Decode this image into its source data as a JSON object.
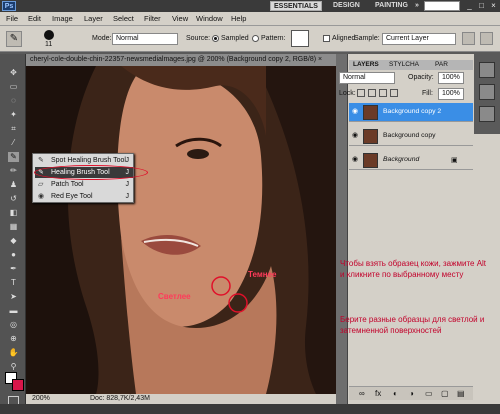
{
  "app": {
    "logo": "Ps",
    "workspaces": [
      "ESSENTIALS",
      "DESIGN",
      "PAINTING"
    ],
    "more": "»",
    "win_buttons": [
      "_",
      "□",
      "×"
    ]
  },
  "menu": [
    "File",
    "Edit",
    "Image",
    "Layer",
    "Select",
    "Filter",
    "View",
    "Window",
    "Help"
  ],
  "options": {
    "brush_size": "11",
    "mode_label": "Mode:",
    "mode_value": "Normal",
    "source_label": "Source:",
    "sampled_label": "Sampled",
    "pattern_label": "Pattern:",
    "aligned_label": "Aligned",
    "sample_label": "Sample:",
    "sample_value": "Current Layer"
  },
  "document": {
    "tab_title": "cheryl-cole-double-chin-22357-newsmedialmages.jpg @ 200% (Background copy 2, RGB/8) ×",
    "zoom": "200%",
    "doc_info": "Doc: 828,7K/2,43M"
  },
  "flyout": {
    "items": [
      {
        "label": "Spot Healing Brush Tool",
        "shortcut": "J"
      },
      {
        "label": "Healing Brush Tool",
        "shortcut": "J"
      },
      {
        "label": "Patch Tool",
        "shortcut": "J"
      },
      {
        "label": "Red Eye Tool",
        "shortcut": "J"
      }
    ]
  },
  "annotations": {
    "light": "Светлее",
    "dark": "Темнее"
  },
  "layers_panel": {
    "tabs": [
      "LAYERS",
      "STYLCHA",
      "PAR"
    ],
    "blend_mode": "Normal",
    "opacity_label": "Opacity:",
    "opacity_value": "100%",
    "lock_label": "Lock:",
    "fill_label": "Fill:",
    "fill_value": "100%",
    "layers": [
      {
        "name": "Background copy 2",
        "selected": true
      },
      {
        "name": "Background copy",
        "selected": false
      },
      {
        "name": "Background",
        "selected": false,
        "locked": true
      }
    ]
  },
  "notes": {
    "note1": "Чтобы взять образец кожи, зажмите Alt и кликните по выбранному месту",
    "note2": "Берите разные образцы для светлой и затемненной поверхностей"
  },
  "colors": {
    "accent": "#3a8ee6",
    "annotation": "#e0102a",
    "note_text": "#c2002a"
  }
}
